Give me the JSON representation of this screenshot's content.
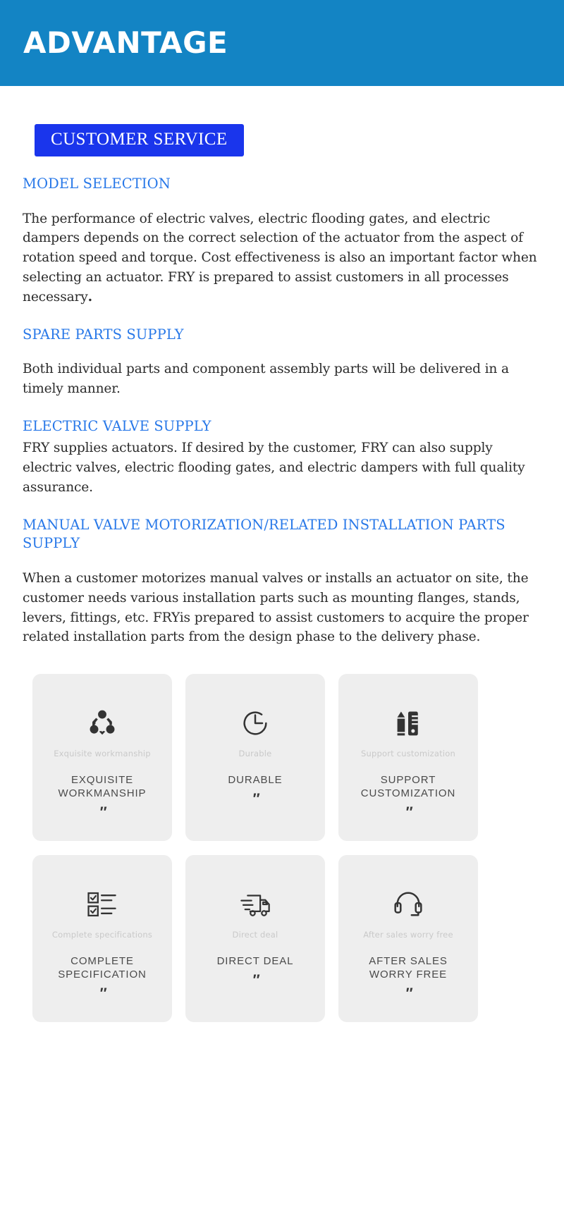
{
  "banner": {
    "title": "ADVANTAGE",
    "bg_color": "#1384c4"
  },
  "badge": {
    "label": "CUSTOMER SERVICE",
    "bg_color": "#1a35ec"
  },
  "heading_color": "#2878e8",
  "sections": [
    {
      "heading": "MODEL SELECTION",
      "body_lead": "The performance of electric valves, electric flooding gates, and electric dampers depends on the correct selection of the actuator from the aspect of rotation speed and torque. Cost effectiveness is also an important factor when selecting an actuator. FRY is prepared to assist customers in all processes necessary",
      "body_tail": "."
    },
    {
      "heading": "SPARE PARTS SUPPLY",
      "body": "Both individual parts and component assembly parts will be delivered in a timely manner."
    },
    {
      "heading": "ELECTRIC VALVE SUPPLY",
      "body": "FRY supplies actuators. If desired by the customer, FRY can also supply electric valves, electric flooding gates, and electric dampers with full quality assurance."
    },
    {
      "heading": "MANUAL VALVE MOTORIZATION/RELATED INSTALLATION PARTS SUPPLY",
      "body": "When a customer motorizes manual valves or installs an actuator on site, the customer needs various installation parts such as mounting flanges, stands, levers, fittings, etc. FRYis prepared to assist customers to acquire the proper related installation parts from the design phase to the delivery phase."
    }
  ],
  "cards": [
    {
      "icon": "network-nodes-icon",
      "subtitle": "Exquisite workmanship",
      "title": "EXQUISITE\nWORKMANSHIP",
      "quote": "″"
    },
    {
      "icon": "clock-icon",
      "subtitle": "Durable",
      "title": "DURABLE",
      "quote": "″"
    },
    {
      "icon": "pencil-ruler-icon",
      "subtitle": "Support customization",
      "title": "SUPPORT\nCUSTOMIZATION",
      "quote": "″"
    },
    {
      "icon": "checklist-icon",
      "subtitle": "Complete specifications",
      "title": "COMPLETE\nSPECIFICATION",
      "quote": "″"
    },
    {
      "icon": "delivery-truck-icon",
      "subtitle": "Direct deal",
      "title": "DIRECT DEAL",
      "quote": "″"
    },
    {
      "icon": "headset-icon",
      "subtitle": "After sales worry free",
      "title": "AFTER SALES\nWORRY FREE",
      "quote": "″"
    }
  ]
}
